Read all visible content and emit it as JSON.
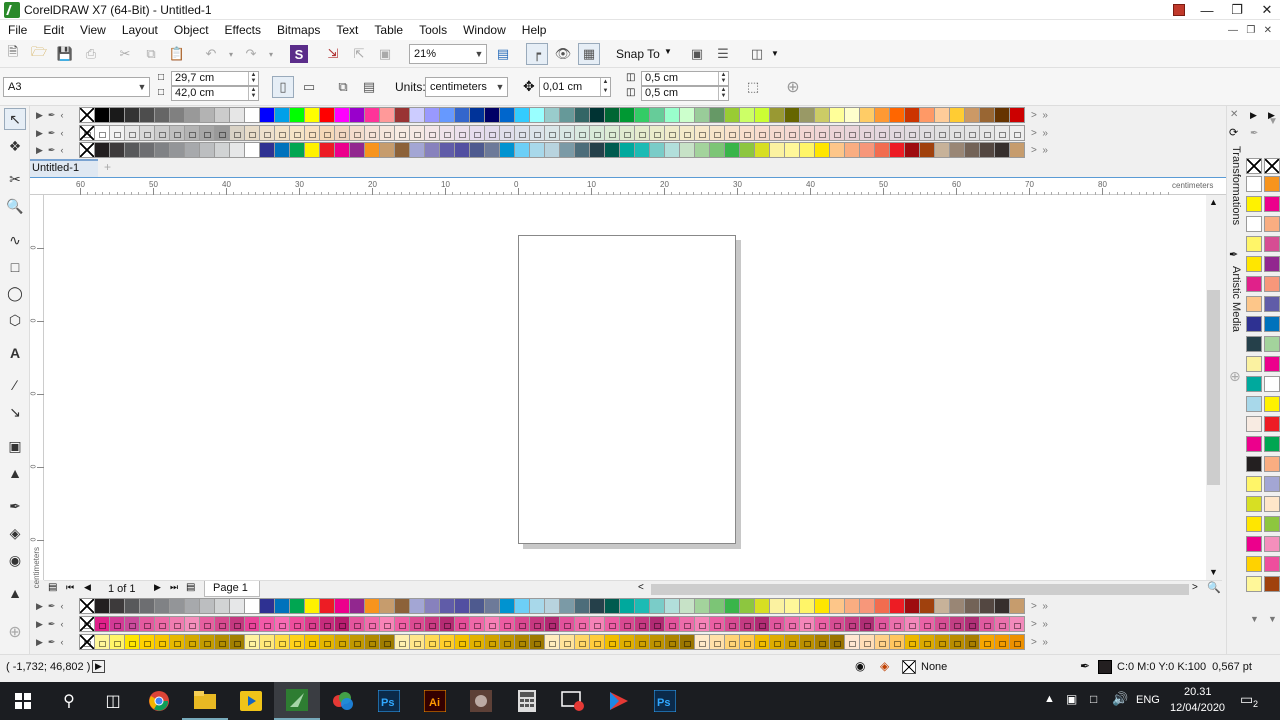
{
  "app": {
    "title": "CorelDRAW X7 (64-Bit) - Untitled-1"
  },
  "menu": [
    "File",
    "Edit",
    "View",
    "Layout",
    "Object",
    "Effects",
    "Bitmaps",
    "Text",
    "Table",
    "Tools",
    "Window",
    "Help"
  ],
  "toolbar": {
    "zoom": "21%",
    "snap_to": "Snap To"
  },
  "property_bar": {
    "paper_size": "A3",
    "width": "29,7 cm",
    "height": "42,0 cm",
    "units_label": "Units:",
    "units_value": "centimeters",
    "nudge": "0,01 cm",
    "dup_x": "0,5 cm",
    "dup_y": "0,5 cm"
  },
  "document_tab": "Untitled-1",
  "ruler": {
    "h_ticks": [
      "60",
      "50",
      "40",
      "30",
      "20",
      "10",
      "0",
      "10",
      "20",
      "30",
      "40",
      "50",
      "60",
      "70",
      "80"
    ],
    "unit": "centimeters",
    "v_ticks": [
      "0",
      "0",
      "0",
      "0",
      "0"
    ]
  },
  "page_nav": {
    "count": "1 of 1",
    "page_tab": "Page 1"
  },
  "docker_tabs": [
    "Transformations",
    "Artistic Media"
  ],
  "status": {
    "coords": "( -1,732; 46,802 )",
    "fill": "None",
    "outline": "C:0 M:0 Y:0 K:100  0,567 pt"
  },
  "taskbar": {
    "lang": "ENG",
    "time": "20.31",
    "date": "12/04/2020",
    "notif": "2"
  },
  "palette_top_1": [
    "#000000",
    "#1a1a1a",
    "#333333",
    "#4d4d4d",
    "#666666",
    "#808080",
    "#999999",
    "#b3b3b3",
    "#cccccc",
    "#e6e6e6",
    "#ffffff",
    "#0000ff",
    "#00a0e9",
    "#00ff00",
    "#ffff00",
    "#ff0000",
    "#ff00ff",
    "#9900cc",
    "#ff3399",
    "#ff9999",
    "#993333",
    "#ccccff",
    "#9999ff",
    "#6699ff",
    "#3366cc",
    "#003399",
    "#000066",
    "#0066cc",
    "#33ccff",
    "#99ffff",
    "#99cccc",
    "#669999",
    "#336666",
    "#003333",
    "#006633",
    "#009933",
    "#33cc66",
    "#66cc99",
    "#99ffcc",
    "#ccffcc",
    "#99cc99",
    "#669966",
    "#99cc33",
    "#ccff66",
    "#ccff33",
    "#999933",
    "#666600",
    "#999966",
    "#cccc66",
    "#ffff99",
    "#ffffcc",
    "#ffcc66",
    "#ff9933",
    "#ff6600",
    "#cc3300",
    "#ff9966",
    "#ffcc99",
    "#ffcc33",
    "#cc9966",
    "#996633",
    "#663300",
    "#cc0000"
  ],
  "palette_top_2": [
    "#ffffff",
    "#f2f2f2",
    "#e6e6e6",
    "#d9d9d9",
    "#cccccc",
    "#bfbfbf",
    "#b3b3b3",
    "#a6a6a6",
    "#999999",
    "#d9d2c5",
    "#e8dcc8",
    "#eee0cc",
    "#f2e2c8",
    "#f6e4c6",
    "#f8e0c0",
    "#f5d9b8",
    "#f1d6c0",
    "#f3dccd",
    "#f5e1d6",
    "#f6e6dc",
    "#f8ebe2",
    "#f6e9e4",
    "#f3e6e8",
    "#efe3ea",
    "#ebe0ec",
    "#e6ddee",
    "#e2dbec",
    "#e0deeb",
    "#dee1ea",
    "#dce4ea",
    "#dae6e8",
    "#d9e8e4",
    "#d8e9df",
    "#d9ead9",
    "#dcebd4",
    "#e0ebd0",
    "#e5ebcd",
    "#eaeccb",
    "#efebca",
    "#f3eac9",
    "#f6e8c9",
    "#f7e5c9",
    "#f8e2ca",
    "#f8dfcc",
    "#f7dccd",
    "#f6dacf",
    "#f4d8d1",
    "#f2d6d3",
    "#efd5d5",
    "#ecd4d7",
    "#e9d4d9",
    "#e6d5db",
    "#e4d6dd",
    "#e2d8de",
    "#e1dadf",
    "#e0dde0",
    "#e0dfe0",
    "#e1e1e1",
    "#e3e3e3",
    "#e6e6e6",
    "#eaeaea",
    "#eeeeee"
  ],
  "palette_top_3": [
    "#231f20",
    "#3d3a3b",
    "#58595b",
    "#6d6e71",
    "#808285",
    "#939598",
    "#a7a9ac",
    "#bcbec0",
    "#d1d3d4",
    "#e6e7e8",
    "#ffffff",
    "#2e3192",
    "#0072bc",
    "#00a651",
    "#fff200",
    "#ed1c24",
    "#ec008c",
    "#92278f",
    "#f7941d",
    "#c69c6d",
    "#8c6239",
    "#a3a6d4",
    "#8781bd",
    "#605ca8",
    "#524fa1",
    "#4e5a8f",
    "#6d7a99",
    "#0093d0",
    "#6dcff6",
    "#a8d8ea",
    "#b8d3de",
    "#7b9aa6",
    "#4d6d7a",
    "#25404a",
    "#005b4f",
    "#00a99d",
    "#1cbbb4",
    "#7accc8",
    "#b2dfdb",
    "#c7e2c7",
    "#a3d39c",
    "#7cc576",
    "#39b54a",
    "#8dc63f",
    "#d7df23",
    "#fbf2a1",
    "#fff799",
    "#fff568",
    "#ffe600",
    "#fdc689",
    "#f9ad81",
    "#f7977a",
    "#f26c4f",
    "#ed1c24",
    "#9e0b0f",
    "#a0410d",
    "#c7b299",
    "#998675",
    "#736357",
    "#534741",
    "#362f2d",
    "#c69c6d"
  ],
  "palette_bot_1": [
    "#231f20",
    "#3d3a3b",
    "#58595b",
    "#6d6e71",
    "#808285",
    "#939598",
    "#a7a9ac",
    "#bcbec0",
    "#d1d3d4",
    "#e6e7e8",
    "#ffffff",
    "#2e3192",
    "#0072bc",
    "#00a651",
    "#fff200",
    "#ed1c24",
    "#ec008c",
    "#92278f",
    "#f7941d",
    "#c69c6d",
    "#8c6239",
    "#a3a6d4",
    "#8781bd",
    "#605ca8",
    "#524fa1",
    "#4e5a8f",
    "#6d7a99",
    "#0093d0",
    "#6dcff6",
    "#a8d8ea",
    "#b8d3de",
    "#7b9aa6",
    "#4d6d7a",
    "#25404a",
    "#005b4f",
    "#00a99d",
    "#1cbbb4",
    "#7accc8",
    "#b2dfdb",
    "#c7e2c7",
    "#a3d39c",
    "#7cc576",
    "#39b54a",
    "#8dc63f",
    "#d7df23",
    "#fbf2a1",
    "#fff799",
    "#fff568",
    "#ffe600",
    "#fdc689",
    "#f9ad81",
    "#f7977a",
    "#f26c4f",
    "#ed1c24",
    "#9e0b0f",
    "#a0410d",
    "#c7b299",
    "#998675",
    "#736357",
    "#534741",
    "#362f2d",
    "#c69c6d"
  ],
  "palette_bot_2": [
    "#e0218a",
    "#d23a96",
    "#c94a9b",
    "#e45a9f",
    "#ec6aa6",
    "#f07cb0",
    "#f48fbc",
    "#e75fa0",
    "#d64a8f",
    "#c4387f",
    "#e9449a",
    "#f25aa8",
    "#f86cb4",
    "#ee4e9d",
    "#db3d8d",
    "#c72c7d",
    "#b71d6f",
    "#e4559d",
    "#f06dac",
    "#f884b8",
    "#ef5fa4",
    "#dc4b92",
    "#c93a82",
    "#b52b73",
    "#e34e98",
    "#ef68a8",
    "#f780b6",
    "#ed5ca2",
    "#d94890",
    "#c63880",
    "#b22972",
    "#e2529b",
    "#ee6aa9",
    "#f682b7",
    "#ec5da3",
    "#d84991",
    "#c53981",
    "#b12a73",
    "#e1549c",
    "#ed6caa",
    "#f584b8",
    "#eb5fa4",
    "#d74b92",
    "#c43b82",
    "#b02c74",
    "#e0569d",
    "#ec6eab",
    "#f486b9",
    "#ea61a5",
    "#d64d93",
    "#c33d83",
    "#af2e75",
    "#df589e",
    "#eb70ac",
    "#f388ba",
    "#e963a6",
    "#d54f94",
    "#c23f84",
    "#ae3076",
    "#de5a9f",
    "#ea72ad",
    "#f28abb"
  ],
  "palette_bot_3": [
    "#fff799",
    "#fff568",
    "#ffe600",
    "#ffd200",
    "#f7c600",
    "#e6b800",
    "#d4a900",
    "#c39b00",
    "#b28d00",
    "#a17f00",
    "#fff3a0",
    "#ffe97a",
    "#ffdd44",
    "#ffd21a",
    "#f5c400",
    "#e4b500",
    "#d2a600",
    "#c19800",
    "#b08a00",
    "#9f7c00",
    "#fff0b0",
    "#ffe68a",
    "#ffda55",
    "#ffcf2b",
    "#f3c100",
    "#e2b200",
    "#d0a300",
    "#bf9500",
    "#ae8700",
    "#9d7900",
    "#ffedbe",
    "#ffe39a",
    "#ffd766",
    "#ffcc3c",
    "#f1be00",
    "#e0af00",
    "#cea000",
    "#bd9200",
    "#ac8400",
    "#9b7600",
    "#ffeac9",
    "#ffe0a8",
    "#ffd477",
    "#ffc94d",
    "#efbb00",
    "#deac00",
    "#cc9d00",
    "#bb8f00",
    "#aa8100",
    "#997300",
    "#ffe7d2",
    "#ffddb6",
    "#ffd188",
    "#ffc65e",
    "#edb800",
    "#dca900",
    "#ca9a00",
    "#b98c00",
    "#a87e00",
    "#f7a600",
    "#f29b00",
    "#ed9000"
  ],
  "palette_right": [
    "#ffffff",
    "#f7941d",
    "#fff200",
    "#ec008c",
    "#ffffff",
    "#f9ad81",
    "#fff568",
    "#d64d93",
    "#ffe600",
    "#92278f",
    "#e0218a",
    "#f7977a",
    "#fdc689",
    "#605ca8",
    "#2e3192",
    "#0072bc",
    "#25404a",
    "#a3d39c",
    "#fbf2a1",
    "#ec008c",
    "#00a99d",
    "#ffffff",
    "#a8d8ea",
    "#fff200",
    "#f8ebe2",
    "#ed1c24",
    "#ec008c",
    "#00a651",
    "#231f20",
    "#f9ad81",
    "#fff568",
    "#a3a6d4",
    "#d7df23",
    "#ffe6c9",
    "#ffe600",
    "#8dc63f",
    "#ec008c",
    "#f48fbc",
    "#ffd200",
    "#ee4e9d",
    "#fff799",
    "#a0410d"
  ]
}
